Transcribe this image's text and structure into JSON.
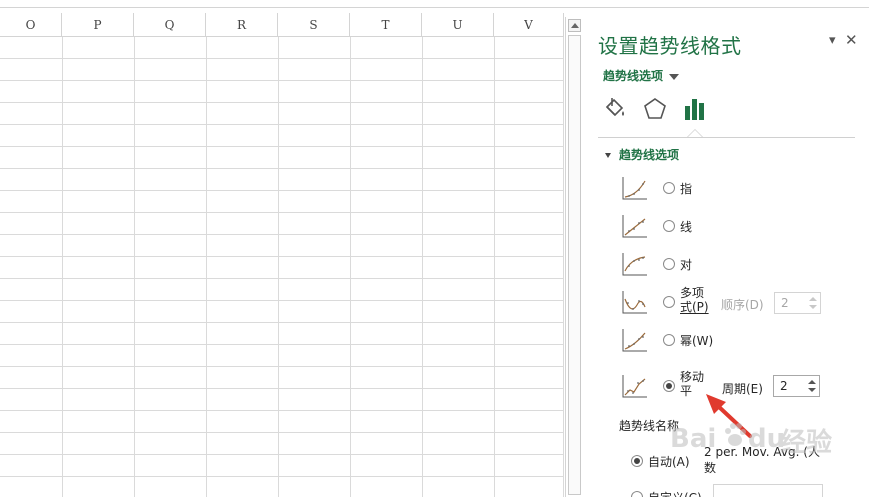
{
  "columns": [
    "O",
    "P",
    "Q",
    "R",
    "S",
    "T",
    "U",
    "V"
  ],
  "pane": {
    "title": "设置趋势线格式",
    "options_dropdown": "趋势线选项",
    "tabs": [
      {
        "icon": "paint-bucket-icon"
      },
      {
        "icon": "pentagon-icon"
      },
      {
        "icon": "bar-chart-icon",
        "selected": true
      }
    ],
    "section": "趋势线选项",
    "options": [
      {
        "label": "指",
        "icon": "exponential-trend-icon",
        "selected": false
      },
      {
        "label": "线",
        "icon": "linear-trend-icon",
        "selected": false
      },
      {
        "label": "对",
        "icon": "logarithmic-trend-icon",
        "selected": false
      },
      {
        "label_line1": "多项",
        "label_line2": "式(P)",
        "icon": "polynomial-trend-icon",
        "selected": false
      },
      {
        "label": "幂(W)",
        "icon": "power-trend-icon",
        "selected": false
      },
      {
        "label_line1": "移动",
        "label_line2": "平",
        "icon": "moving-average-trend-icon",
        "selected": true
      }
    ],
    "order": {
      "label": "顺序(D)",
      "value": "2",
      "disabled": true
    },
    "period": {
      "label": "周期(E)",
      "value": "2"
    },
    "name_section": "趋势线名称",
    "name_auto": {
      "label": "自动(A)",
      "text": "2 per. Mov. Avg. (人数",
      "selected": true
    },
    "name_custom": {
      "label": "自定义(C)",
      "selected": false
    }
  },
  "watermark": {
    "brand": "Bai",
    "brand2": "du",
    "suffix": "经验"
  },
  "colors": {
    "accent": "#217346",
    "arrow": "#e03a2e",
    "grid": "#dadada"
  }
}
